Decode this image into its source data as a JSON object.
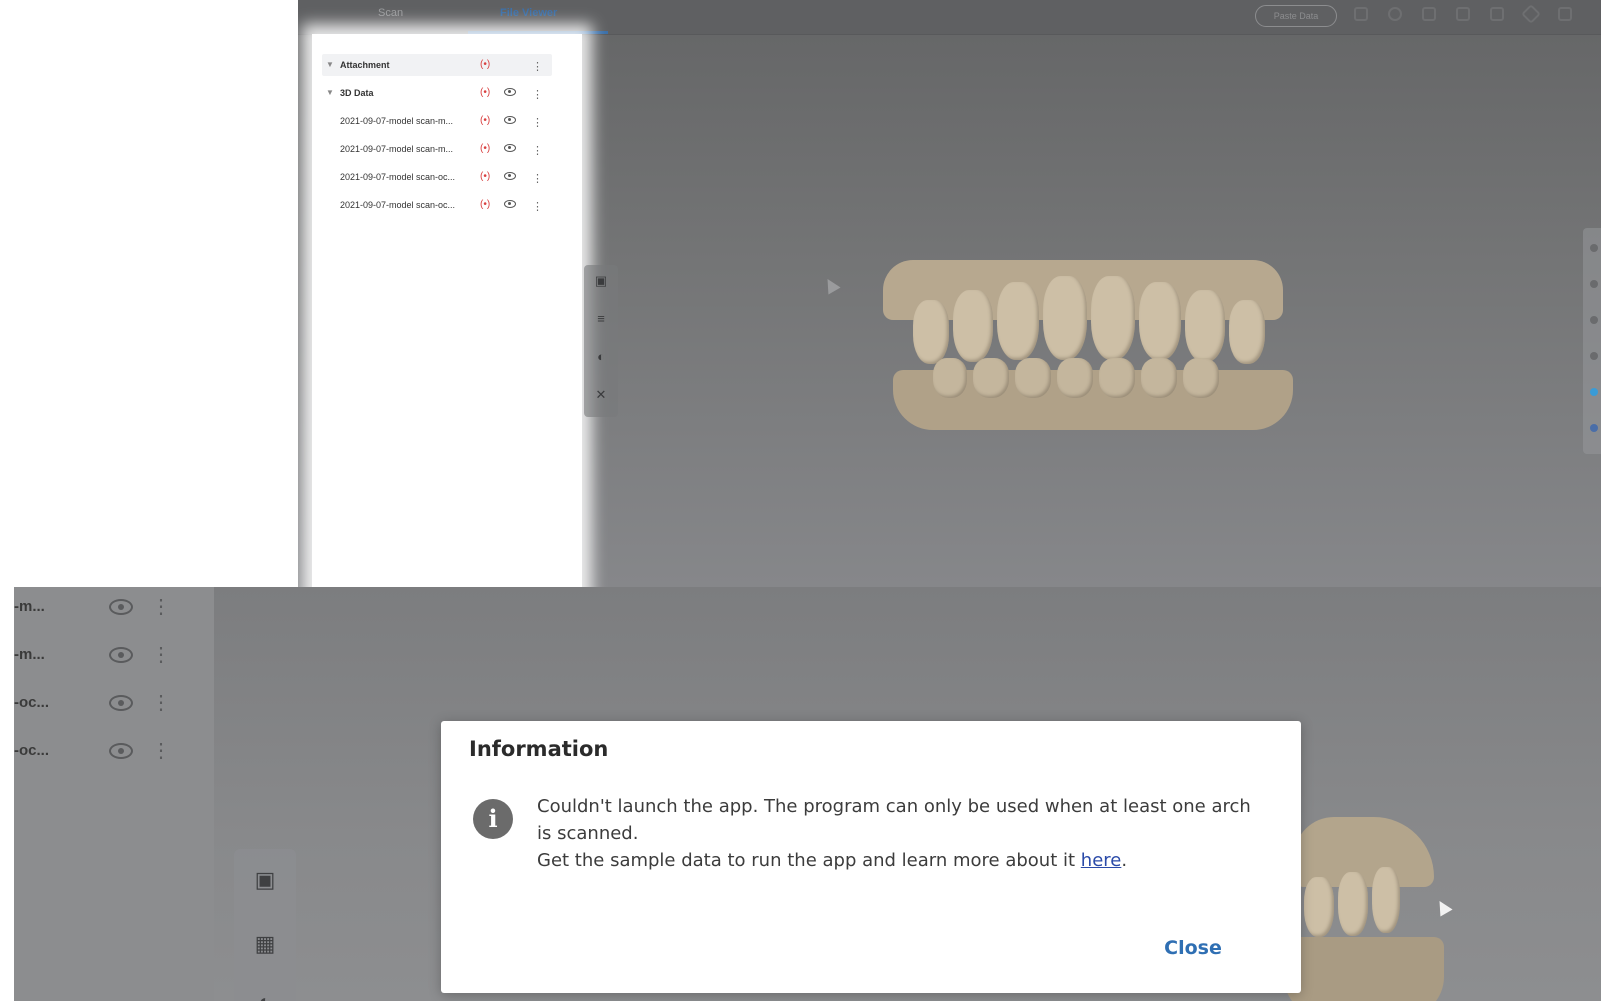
{
  "top": {
    "tabs": [
      {
        "label": "Scan"
      },
      {
        "label": "File Viewer"
      }
    ],
    "pill_button": "Paste Data",
    "file_tree": {
      "attachment_label": "Attachment",
      "group_label": "3D Data",
      "items": [
        {
          "label": "2021-09-07-model scan-m..."
        },
        {
          "label": "2021-09-07-model scan-m..."
        },
        {
          "label": "2021-09-07-model scan-oc..."
        },
        {
          "label": "2021-09-07-model scan-oc..."
        }
      ]
    }
  },
  "bottom": {
    "rows": [
      {
        "label": "-m..."
      },
      {
        "label": "-m..."
      },
      {
        "label": "-oc..."
      },
      {
        "label": "-oc..."
      }
    ]
  },
  "dialog": {
    "title": "Information",
    "message_line1": "Couldn't launch the app. The program can only be used when at least one arch is scanned.",
    "message_line2_prefix": "Get the sample data to run the app and learn more about it ",
    "link_text": "here",
    "message_line2_suffix": ".",
    "close_label": "Close"
  },
  "colors": {
    "accent": "#2f6fb3",
    "link": "#2a4aa8",
    "hide_icon": "#d94040"
  },
  "icons": [
    "chevron-down-icon",
    "hide-icon",
    "eye-icon",
    "more-vert-icon",
    "fit-view-icon",
    "align-icon",
    "half-sphere-icon",
    "scissors-icon",
    "info-icon",
    "cursor-icon"
  ]
}
